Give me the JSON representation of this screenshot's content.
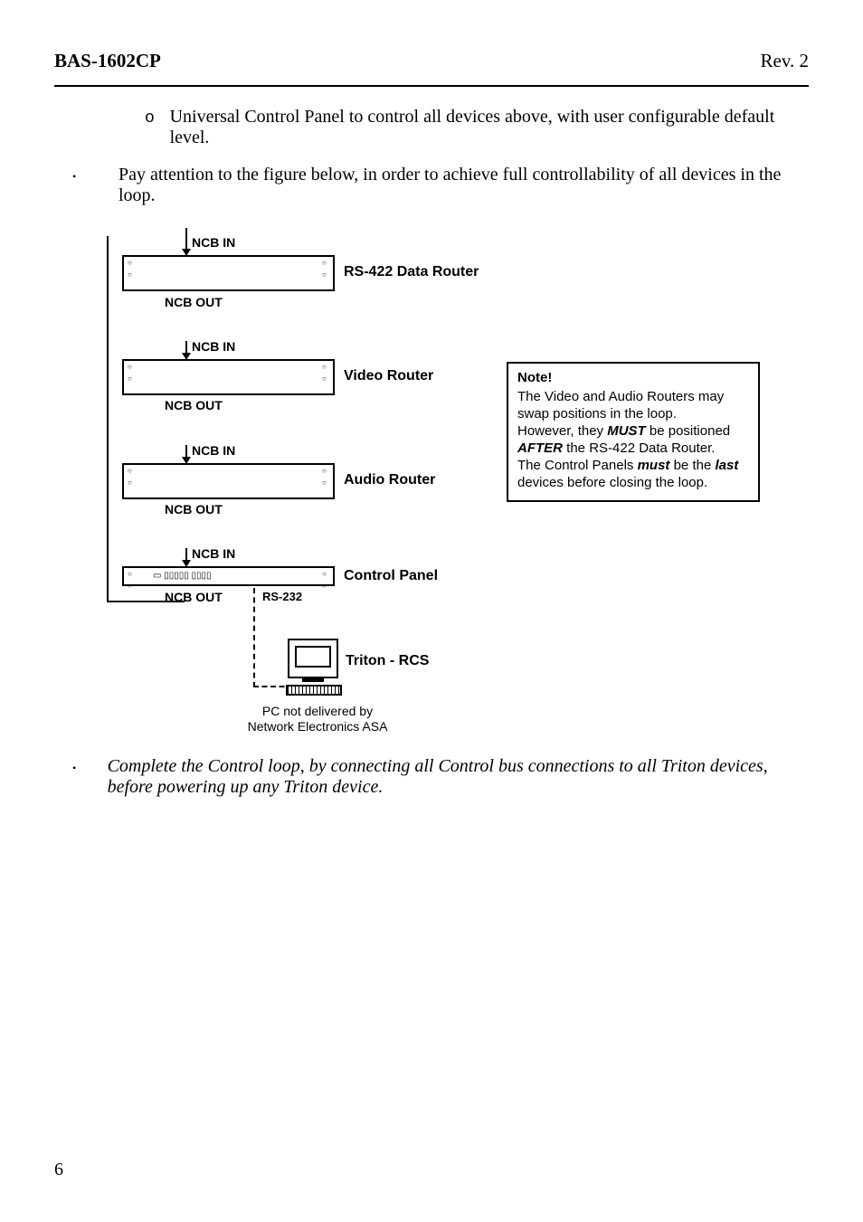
{
  "header": {
    "left": "BAS-1602CP",
    "right": "Rev. 2"
  },
  "bullet_sub_o": "o",
  "bullet_main": "•",
  "text_sub1": "Universal Control Panel to control all devices above, with user configurable default level.",
  "text_main1": "Pay attention to the figure below, in order to achieve full controllability of all devices in the loop.",
  "text_main2a": "Complete the Control loop, by connecting all Control bus connections to all Triton devices, before powering up any Triton device",
  "text_main2_tail": ".",
  "diagram": {
    "ncb_in": "NCB IN",
    "ncb_out": "NCB OUT",
    "rs232": "RS-232",
    "dev1": "RS-422 Data Router",
    "dev2": "Video Router",
    "dev3": "Audio Router",
    "dev4": "Control Panel",
    "triton": "Triton - RCS",
    "pc_note_l1": "PC not delivered by",
    "pc_note_l2": "Network Electronics ASA"
  },
  "note": {
    "title": "Note!",
    "l1": "The Video and Audio Routers may swap positions in the loop.",
    "l2a": "However, they ",
    "l2b": "MUST ",
    "l2c": "be positioned ",
    "l3a": "AFTER ",
    "l3b": "the RS-422 Data Router.",
    "l4a": "The Control Panels ",
    "l4b": "must ",
    "l4c": "be the ",
    "l4d": "last",
    "l5": "devices before closing the loop."
  },
  "page_number": "6"
}
